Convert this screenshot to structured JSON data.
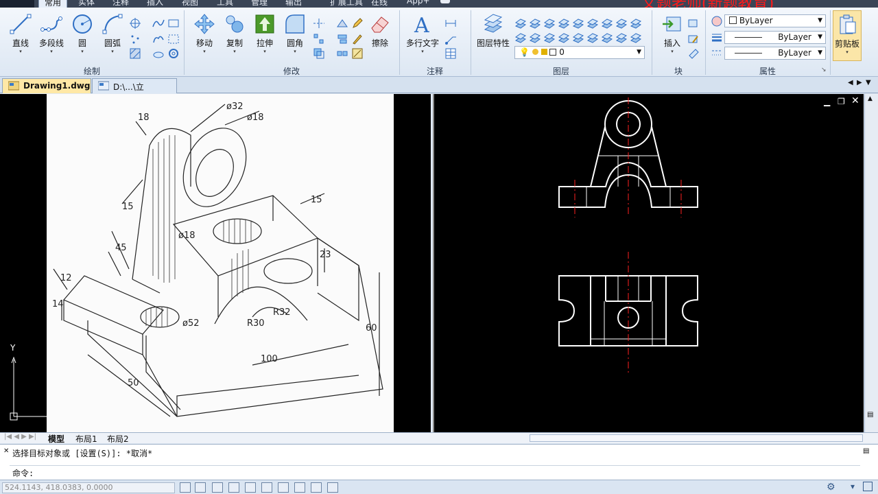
{
  "ribbon_tabs": {
    "home": "常用",
    "solid": "实体",
    "annotate": "注释",
    "insert": "插入",
    "view": "视图",
    "tools": "工具",
    "manage": "管理",
    "output": "输出",
    "extensions": "扩展工具",
    "online": "在线",
    "apps": "App+"
  },
  "watermark": "文题老师(新题教育)",
  "draw_panel": {
    "title": "绘制",
    "line": "直线",
    "polyline": "多段线",
    "circle": "圆",
    "arc": "圆弧"
  },
  "modify_panel": {
    "title": "修改",
    "move": "移动",
    "copy": "复制",
    "stretch": "拉伸",
    "fillet": "圆角",
    "erase": "擦除"
  },
  "annotation_panel": {
    "title": "注释",
    "mtext": "多行文字"
  },
  "layer_panel": {
    "title": "图层",
    "layer_props": "图层特性",
    "current_layer": "0"
  },
  "block_panel": {
    "title": "块",
    "insert": "插入"
  },
  "properties_panel": {
    "title": "属性",
    "color": "ByLayer",
    "linetype": "ByLayer",
    "lineweight": "ByLayer"
  },
  "clipboard_panel": {
    "title": "剪贴板"
  },
  "doc_tabs": {
    "tab1": "Drawing1.dwg",
    "tab2": "D:\\...\\立体.dwg"
  },
  "layout_tabs": {
    "model": "模型",
    "layout1": "布局1",
    "layout2": "布局2"
  },
  "ucs": {
    "y_label": "Y"
  },
  "drawing_dims": {
    "d18": "18",
    "d32": "ø32",
    "d18b": "ø18",
    "d15a": "15",
    "d15b": "15",
    "d45": "45",
    "dphi18": "ø18",
    "d23": "23",
    "d12": "12",
    "d14": "14",
    "d52": "ø52",
    "r30": "R30",
    "r32": "R32",
    "d60": "60",
    "d100": "100",
    "d50": "50"
  },
  "command": {
    "prompt1": "选择目标对象或 [设置(S)]: *取消*",
    "prompt2": "命令:"
  },
  "status": {
    "coords": "524.1143,  418.0383,  0.0000"
  },
  "colors": {
    "accent": "#ffe8a6",
    "drawing_line": "#ffffff",
    "center_line": "#ff2020"
  }
}
